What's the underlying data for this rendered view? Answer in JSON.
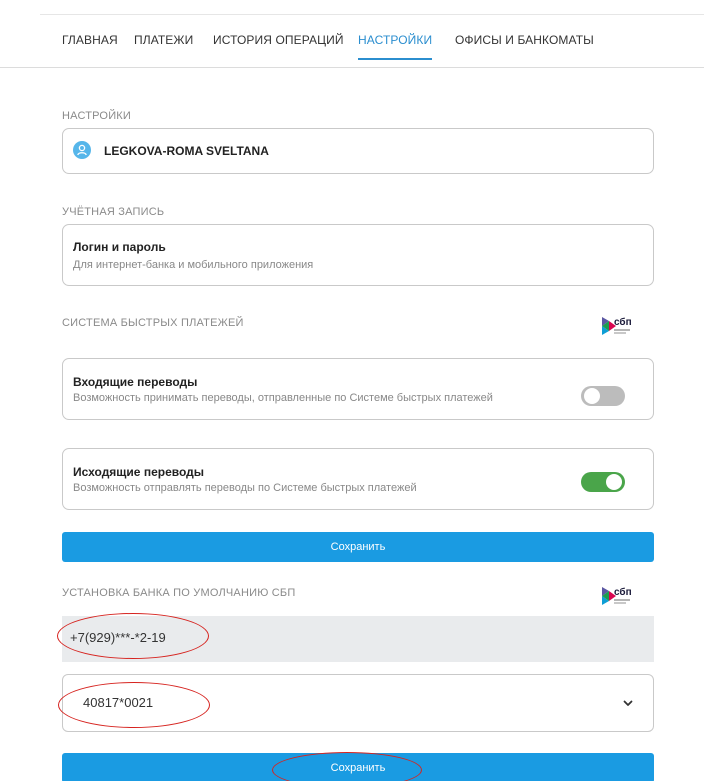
{
  "nav": {
    "items": [
      {
        "label": "ГЛАВНАЯ"
      },
      {
        "label": "ПЛАТЕЖИ"
      },
      {
        "label": "ИСТОРИЯ ОПЕРАЦИЙ"
      },
      {
        "label": "НАСТРОЙКИ"
      },
      {
        "label": "ОФИСЫ И БАНКОМАТЫ"
      }
    ],
    "active": "НАСТРОЙКИ"
  },
  "settings": {
    "section_label": "НАСТРОЙКИ",
    "user_name": "LEGKOVA-ROMA SVELTANA"
  },
  "account": {
    "section_label": "УЧЁТНАЯ ЗАПИСЬ",
    "title": "Логин и пароль",
    "subtitle": "Для интернет-банка и мобильного приложения"
  },
  "sbp": {
    "section_label": "СИСТЕМА БЫСТРЫХ ПЛАТЕЖЕЙ",
    "logo_text": "сбп",
    "incoming": {
      "title": "Входящие переводы",
      "subtitle": "Возможность принимать переводы, отправленные по Системе быстрых платежей",
      "enabled": false
    },
    "outgoing": {
      "title": "Исходящие переводы",
      "subtitle": "Возможность отправлять переводы по Системе быстрых платежей",
      "enabled": true
    },
    "save_label": "Сохранить"
  },
  "default_bank": {
    "section_label": "УСТАНОВКА БАНКА ПО УМОЛЧАНИЮ СБП",
    "logo_text": "сбп",
    "phone": "+7(929)***-*2-19",
    "account": "40817*0021",
    "save_label": "Сохранить"
  },
  "colors": {
    "accent": "#2b8ecf",
    "button": "#1a9be2",
    "toggle_on": "#4aa54a",
    "toggle_off": "#bcbcbc",
    "annotation": "#d6231f"
  }
}
